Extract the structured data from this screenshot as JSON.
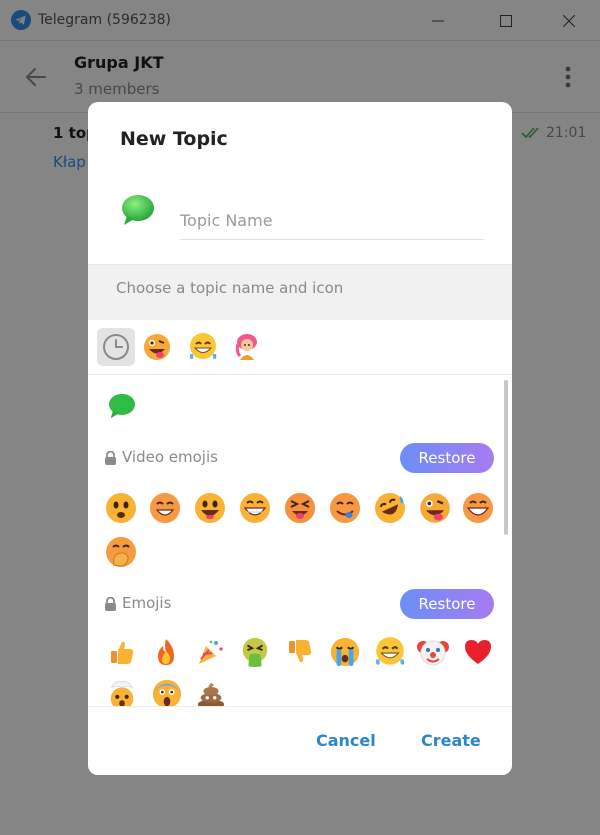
{
  "window": {
    "title": "Telegram (596238)"
  },
  "chat": {
    "title": "Grupa JKT",
    "subtitle": "3 members",
    "preview_topic": "1 top",
    "preview_link": "Kłap",
    "time": "21:01"
  },
  "dialog": {
    "title": "New Topic",
    "input_placeholder": "Topic Name",
    "hint": "Choose a topic name and icon",
    "sections": {
      "video": {
        "label": "Video emojis",
        "restore_label": "Restore"
      },
      "emojis": {
        "label": "Emojis",
        "restore_label": "Restore"
      }
    },
    "cancel_label": "Cancel",
    "create_label": "Create"
  },
  "colors": {
    "accent": "#2c86c9",
    "link": "#3390ec",
    "restore_gradient_start": "#6b8ef6",
    "restore_gradient_end": "#a67cf2",
    "read_check": "#4caf50"
  },
  "icons": {
    "tabs": [
      "clock-icon",
      "zany-face-icon",
      "grinning-sweat-icon",
      "girl-pink-hair-icon"
    ],
    "video_emojis": [
      "smiling-face-icon",
      "grinning-face-icon",
      "grinning-big-eyes-icon",
      "beaming-face-icon",
      "squinting-tongue-icon",
      "savoring-food-icon",
      "rolling-laughing-icon",
      "zany-face-icon",
      "big-grin-icon",
      "hand-over-mouth-icon"
    ],
    "emojis": [
      "thumbs-up-icon",
      "fire-icon",
      "party-popper-icon",
      "vomiting-face-icon",
      "thumbs-down-icon",
      "crying-face-icon",
      "sweat-smile-icon",
      "clown-face-icon",
      "red-heart-icon",
      "exploding-head-icon",
      "screaming-face-icon",
      "poop-icon"
    ]
  }
}
